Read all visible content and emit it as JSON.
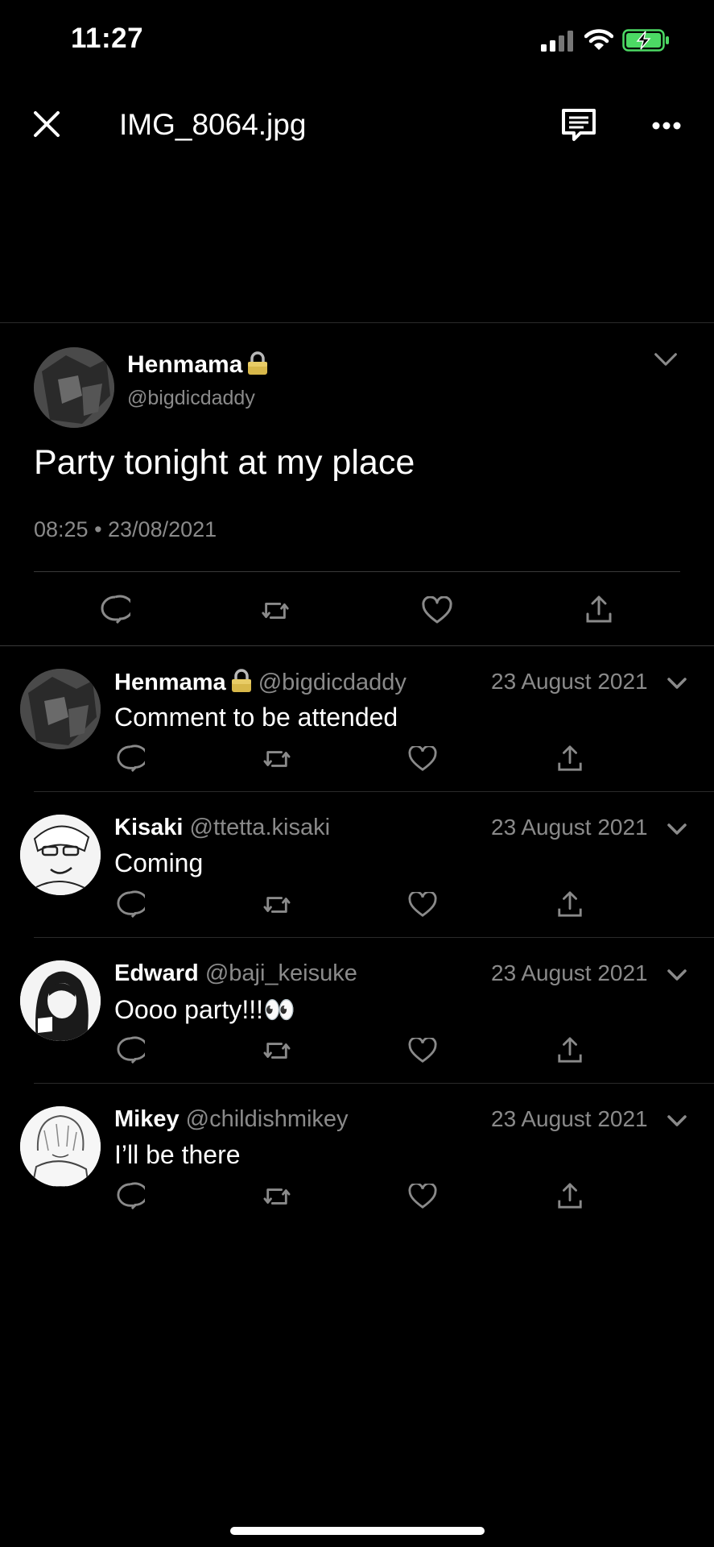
{
  "status_bar": {
    "time": "11:27",
    "icons": [
      "signal-icon",
      "wifi-icon",
      "battery-charging-icon"
    ]
  },
  "nav": {
    "close_icon": "close-icon",
    "filename": "IMG_8064.jpg",
    "comment_icon": "comment-icon",
    "more_icon": "more-icon"
  },
  "main_tweet": {
    "name": "Henmama",
    "name_emoji": "lock-icon",
    "handle": "@bigdicdaddy",
    "text": "Party tonight at my place",
    "timestamp": "08:25 • 23/08/2021"
  },
  "replies": [
    {
      "name": "Henmama",
      "locked": true,
      "handle": "@bigdicdaddy",
      "date": "23 August 2021",
      "text": "Comment to be attended"
    },
    {
      "name": "Kisaki",
      "handle": "@ttetta.kisaki",
      "date": "23 August 2021",
      "text": "Coming"
    },
    {
      "name": "Edward",
      "handle": "@baji_keisuke",
      "date": "23 August 2021",
      "text": "Oooo party!!!👀"
    },
    {
      "name": "Mikey",
      "handle": "@childishmikey",
      "date": "23 August 2021",
      "text": "I’ll be there"
    }
  ],
  "colors": {
    "background": "#000000",
    "text": "#ffffff",
    "secondary": "#8a8a8a",
    "battery": "#4cd964"
  }
}
